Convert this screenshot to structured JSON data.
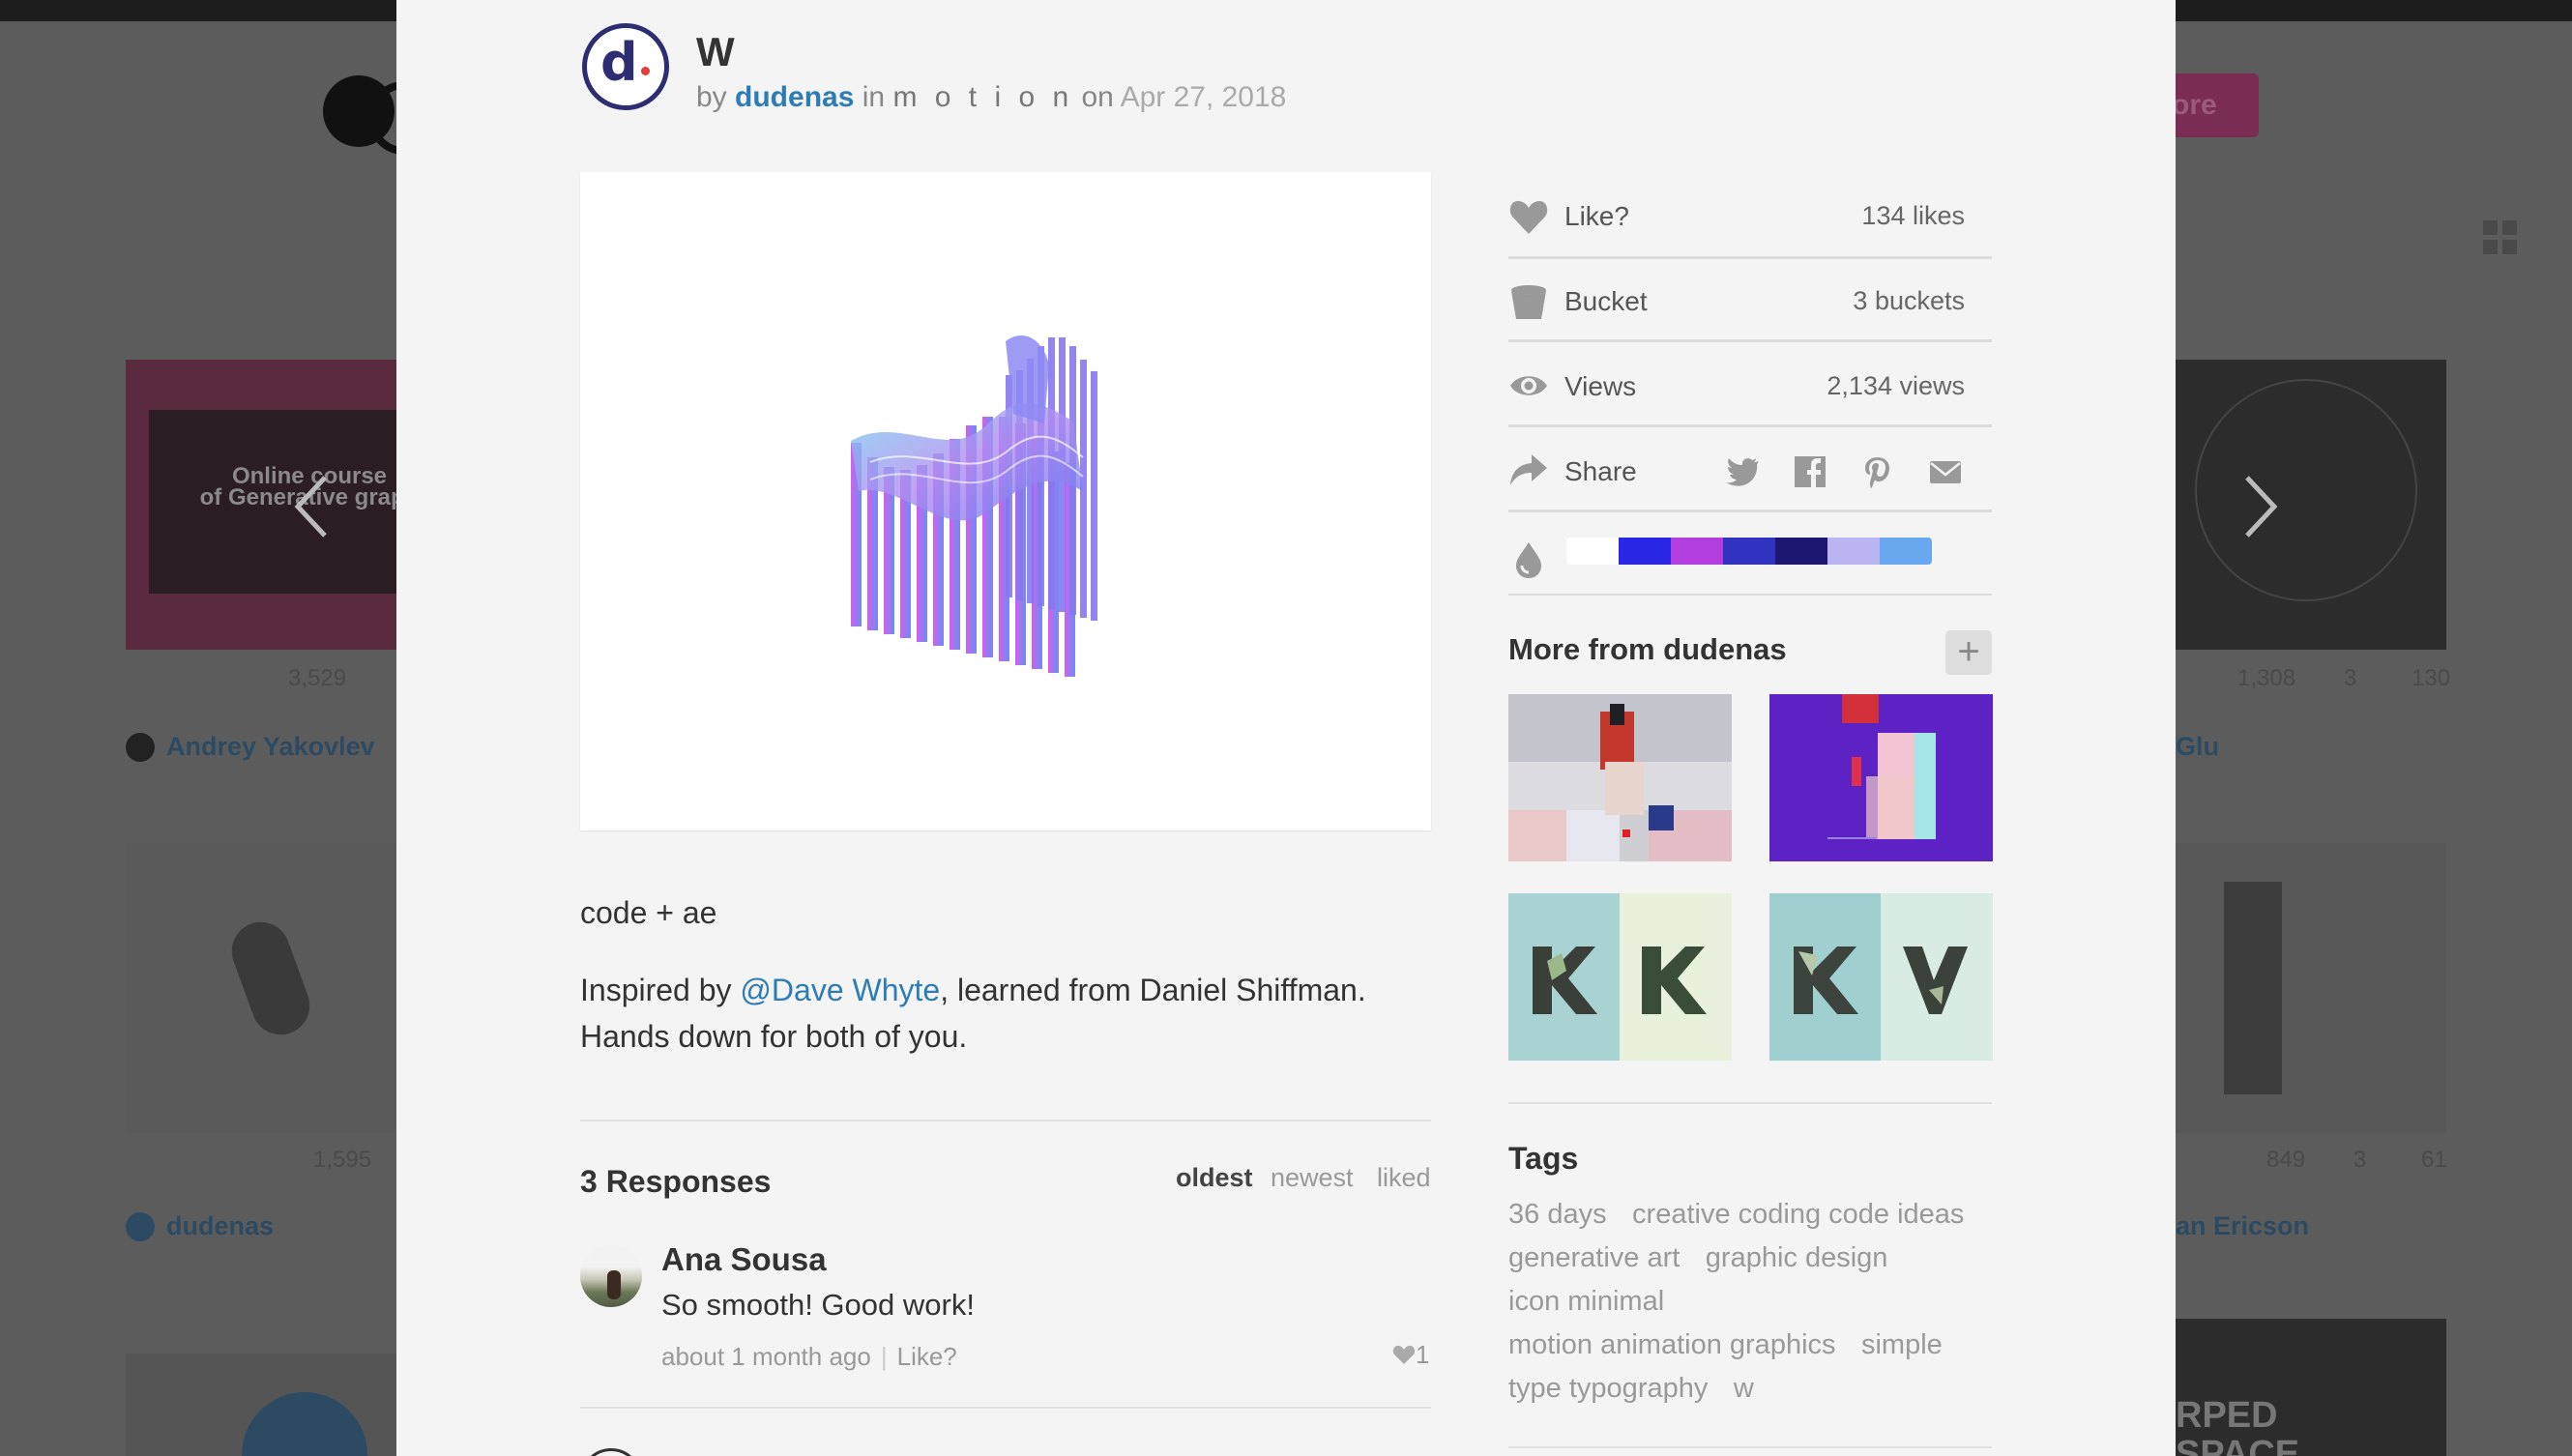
{
  "background": {
    "more_button_label": "ore",
    "left_shot_text": "Online course\nof Generative graph",
    "left_stats": [
      "3,529",
      "1,595"
    ],
    "left_authors": [
      "Andrey Yakovlev",
      "dudenas"
    ],
    "right_stats_top": [
      "1,308",
      "3",
      "130"
    ],
    "right_stats_mid": [
      "849",
      "3",
      "61"
    ],
    "right_authors": [
      "Glu",
      "an Ericson"
    ],
    "right_bottom_text": "RPED\nSPACE"
  },
  "shot": {
    "title": "W",
    "by_label": "by",
    "author": "dudenas",
    "in_label": "in",
    "team": "m o t i o n",
    "on_label": "on",
    "date": "Apr 27, 2018"
  },
  "description": {
    "line1": "code + ae",
    "inspired_prefix": "Inspired by ",
    "mention": "@Dave Whyte",
    "inspired_suffix": ", learned from Daniel Shiffman. Hands down for both of you."
  },
  "responses": {
    "title": "3 Responses",
    "sort_options": [
      "oldest",
      "newest",
      "liked"
    ],
    "active_sort": "oldest",
    "comments": [
      {
        "name": "Ana Sousa",
        "text": "So smooth! Good work!",
        "time": "about 1 month ago",
        "like_label": "Like?",
        "likes": "1"
      }
    ]
  },
  "sidebar": {
    "like": {
      "label": "Like?",
      "value": "134 likes",
      "icon": "heart-icon"
    },
    "bucket": {
      "label": "Bucket",
      "value": "3 buckets",
      "icon": "bucket-icon"
    },
    "views": {
      "label": "Views",
      "value": "2,134 views",
      "icon": "eye-icon"
    },
    "share": {
      "label": "Share",
      "icon": "share-arrow-icon",
      "targets": [
        "twitter",
        "facebook",
        "pinterest",
        "email"
      ]
    },
    "palette": [
      "#ffffff",
      "#2a26e6",
      "#b33ddd",
      "#2f33c0",
      "#1c1670",
      "#b9b4f2",
      "#69a8ee"
    ],
    "more_from_title": "More from dudenas",
    "plus_label": "+",
    "tags_title": "Tags",
    "tags": [
      "36 days",
      "creative coding code ideas",
      "generative art",
      "graphic design",
      "icon minimal",
      "motion animation graphics",
      "simple",
      "type typography",
      "w"
    ]
  },
  "colors": {
    "link": "#2d7cb4",
    "modal_bg": "#f4f4f4",
    "overlay_bg": "#5c5c5c"
  }
}
